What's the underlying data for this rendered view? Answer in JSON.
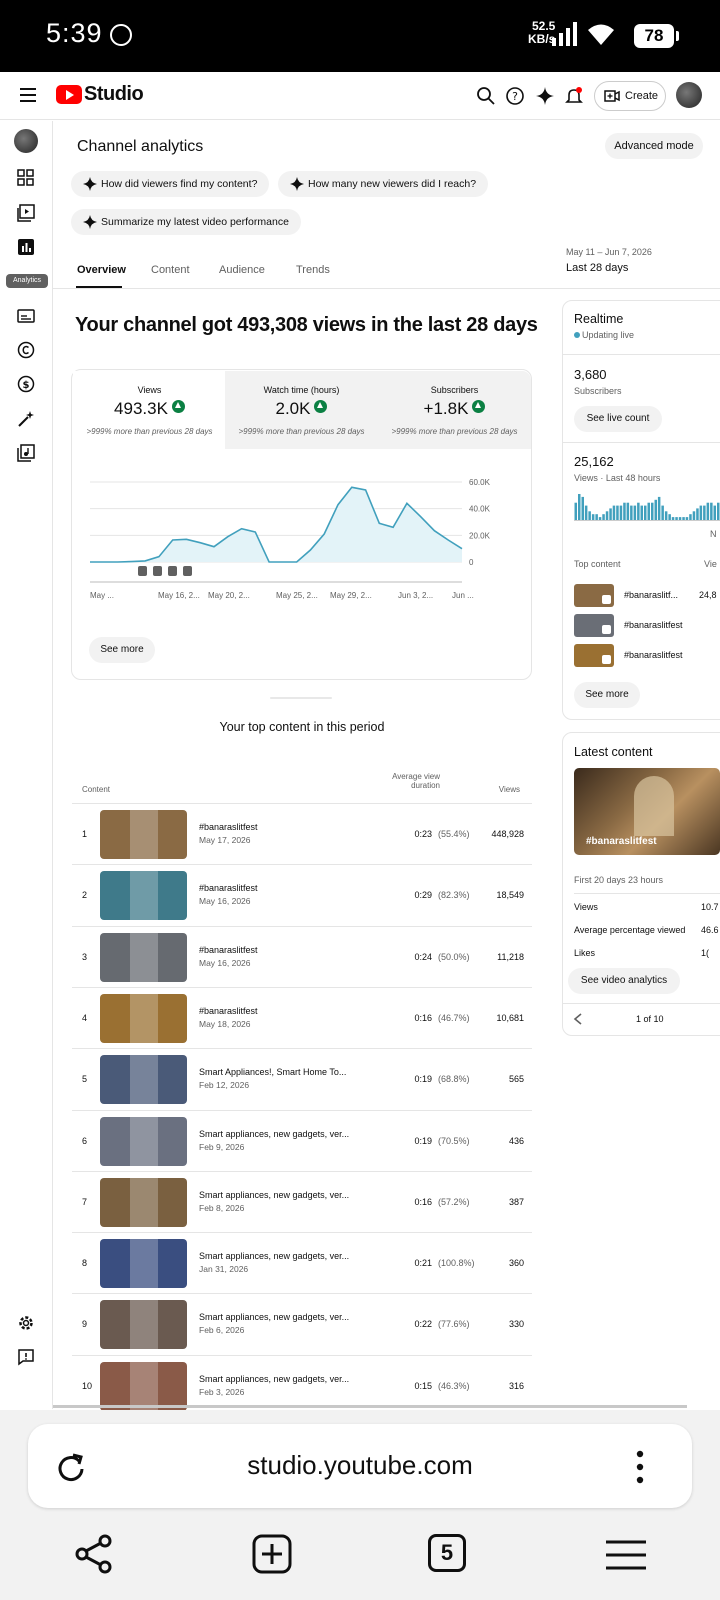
{
  "status_bar": {
    "time": "5:39",
    "net_speed": "52.5",
    "net_unit": "KB/s",
    "battery": "78"
  },
  "header": {
    "brand": "Studio",
    "create_label": "Create"
  },
  "sidebar": {
    "tooltip": "Analytics"
  },
  "page": {
    "title": "Channel analytics",
    "advanced_mode": "Advanced mode",
    "chips": [
      "How did viewers find my content?",
      "How many new viewers did I reach?",
      "Summarize my latest video performance"
    ],
    "tabs": [
      "Overview",
      "Content",
      "Audience",
      "Trends"
    ],
    "date_range": "May 11 – Jun 7, 2026",
    "date_label": "Last 28 days",
    "headline": "Your channel got 493,308 views in the last 28 days"
  },
  "metrics": [
    {
      "label": "Views",
      "value": "493.3K",
      "compare": ">999% more than previous 28 days"
    },
    {
      "label": "Watch time (hours)",
      "value": "2.0K",
      "compare": ">999% more than previous 28 days"
    },
    {
      "label": "Subscribers",
      "value": "+1.8K",
      "compare": ">999% more than previous 28 days"
    }
  ],
  "chart_data": {
    "type": "area",
    "x": [
      "May 11",
      "May 12",
      "May 13",
      "May 14",
      "May 15",
      "May 16",
      "May 17",
      "May 18",
      "May 19",
      "May 20",
      "May 21",
      "May 22",
      "May 23",
      "May 24",
      "May 25",
      "May 26",
      "May 27",
      "May 28",
      "May 29",
      "May 30",
      "May 31",
      "Jun 1",
      "Jun 2",
      "Jun 3",
      "Jun 4",
      "Jun 5",
      "Jun 6",
      "Jun 7"
    ],
    "values": [
      0,
      0,
      0,
      300,
      800,
      4000,
      16500,
      17000,
      14500,
      11500,
      19000,
      25000,
      22500,
      0,
      0,
      0,
      9000,
      21000,
      43000,
      56000,
      54000,
      29000,
      26000,
      44000,
      34000,
      23500,
      16500,
      10000
    ],
    "x_tick_labels": [
      "May ...",
      "May 16, 2...",
      "May 20, 2...",
      "May 25, 2...",
      "May 29, 2...",
      "Jun 3, 2...",
      "Jun ..."
    ],
    "y_tick_labels": [
      "60.0K",
      "40.0K",
      "20.0K",
      "0"
    ],
    "ylim": [
      0,
      60000
    ],
    "grid": true,
    "color": "#41a0bd",
    "fill": "#e3f3f8"
  },
  "chart_see_more": "See more",
  "top_content": {
    "title": "Your top content in this period",
    "headers": {
      "content": "Content",
      "avd_1": "Average view",
      "avd_2": "duration",
      "views": "Views"
    },
    "rows": [
      {
        "n": "1",
        "title": "#banaraslitfest",
        "date": "May 17, 2026",
        "dur": "0:23",
        "pct": "(55.4%)",
        "views": "448,928",
        "color": "#8a6a44"
      },
      {
        "n": "2",
        "title": "#banaraslitfest",
        "date": "May 16, 2026",
        "dur": "0:29",
        "pct": "(82.3%)",
        "views": "18,549",
        "color": "#3f7a8a"
      },
      {
        "n": "3",
        "title": "#banaraslitfest",
        "date": "May 16, 2026",
        "dur": "0:24",
        "pct": "(50.0%)",
        "views": "11,218",
        "color": "#666a70"
      },
      {
        "n": "4",
        "title": "#banaraslitfest",
        "date": "May 18, 2026",
        "dur": "0:16",
        "pct": "(46.7%)",
        "views": "10,681",
        "color": "#9a7032"
      },
      {
        "n": "5",
        "title": "Smart Appliances!, Smart Home To...",
        "date": "Feb 12, 2026",
        "dur": "0:19",
        "pct": "(68.8%)",
        "views": "565",
        "color": "#4a5a78"
      },
      {
        "n": "6",
        "title": "Smart appliances, new gadgets, ver...",
        "date": "Feb 9, 2026",
        "dur": "0:19",
        "pct": "(70.5%)",
        "views": "436",
        "color": "#6a7080"
      },
      {
        "n": "7",
        "title": "Smart appliances, new gadgets, ver...",
        "date": "Feb 8, 2026",
        "dur": "0:16",
        "pct": "(57.2%)",
        "views": "387",
        "color": "#7a6040"
      },
      {
        "n": "8",
        "title": "Smart appliances, new gadgets, ver...",
        "date": "Jan 31, 2026",
        "dur": "0:21",
        "pct": "(100.8%)",
        "views": "360",
        "color": "#3a4e80"
      },
      {
        "n": "9",
        "title": "Smart appliances, new gadgets, ver...",
        "date": "Feb 6, 2026",
        "dur": "0:22",
        "pct": "(77.6%)",
        "views": "330",
        "color": "#6a5a50"
      },
      {
        "n": "10",
        "title": "Smart appliances, new gadgets, ver...",
        "date": "Feb 3, 2026",
        "dur": "0:15",
        "pct": "(46.3%)",
        "views": "316",
        "color": "#8a5a48"
      }
    ]
  },
  "realtime": {
    "title": "Realtime",
    "live": "Updating live",
    "subs_value": "3,680",
    "subs_label": "Subscribers",
    "live_count_btn": "See live count",
    "views_value": "25,162",
    "views_label": "Views · Last 48 hours",
    "bars": [
      6,
      9,
      8,
      5,
      3,
      2,
      2,
      1,
      2,
      3,
      4,
      5,
      5,
      5,
      6,
      6,
      5,
      5,
      6,
      5,
      5,
      6,
      6,
      7,
      8,
      5,
      3,
      2,
      1,
      1,
      1,
      1,
      1,
      2,
      3,
      4,
      5,
      5,
      6,
      6,
      5,
      6
    ],
    "axis_end": "N",
    "top_content_label": "Top content",
    "top_content_col": "Vie",
    "top_items": [
      {
        "title": "#banaraslitf...",
        "views": "24,8",
        "color": "#8a6a44"
      },
      {
        "title": "#banaraslitfest",
        "views": "",
        "color": "#6a6e76"
      },
      {
        "title": "#banaraslitfest",
        "views": "",
        "color": "#9a7032"
      }
    ],
    "see_more": "See more"
  },
  "latest": {
    "title": "Latest content",
    "video_title": "#banaraslitfest",
    "period": "First 20 days 23 hours",
    "stats": [
      {
        "label": "Views",
        "value": "10.7"
      },
      {
        "label": "Average percentage viewed",
        "value": "46.6"
      },
      {
        "label": "Likes",
        "value": "1("
      }
    ],
    "btn": "See video analytics",
    "pager": "1 of 10"
  },
  "browser": {
    "url": "studio.youtube.com",
    "tab_count": "5"
  }
}
